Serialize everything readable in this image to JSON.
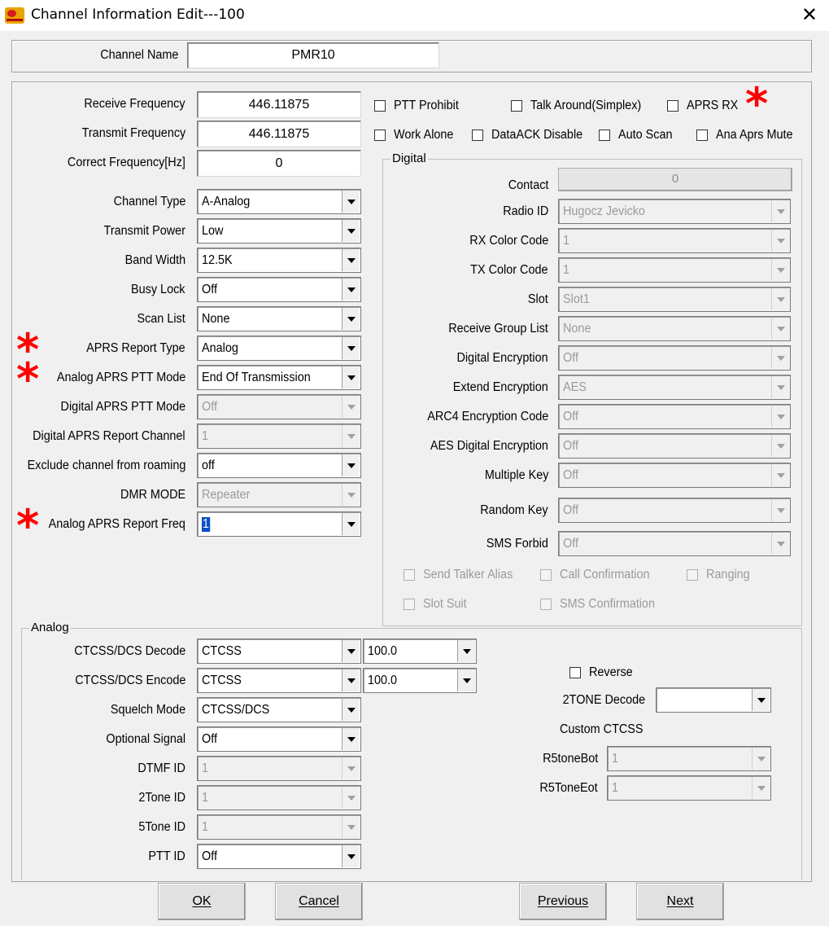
{
  "window": {
    "title": "Channel Information Edit---100",
    "close": "✕"
  },
  "channel_name": {
    "label": "Channel Name",
    "value": "PMR10"
  },
  "left": {
    "receive_frequency": {
      "label": "Receive Frequency",
      "value": "446.11875"
    },
    "transmit_frequency": {
      "label": "Transmit Frequency",
      "value": "446.11875"
    },
    "correct_frequency": {
      "label": "Correct Frequency[Hz]",
      "value": "0"
    },
    "channel_type": {
      "label": "Channel Type",
      "value": "A-Analog"
    },
    "transmit_power": {
      "label": "Transmit Power",
      "value": "Low"
    },
    "band_width": {
      "label": "Band Width",
      "value": "12.5K"
    },
    "busy_lock": {
      "label": "Busy Lock",
      "value": "Off"
    },
    "scan_list": {
      "label": "Scan List",
      "value": "None"
    },
    "aprs_report_type": {
      "label": "APRS Report Type",
      "value": "Analog"
    },
    "analog_aprs_ptt_mode": {
      "label": "Analog APRS PTT Mode",
      "value": "End Of Transmission"
    },
    "digital_aprs_ptt_mode": {
      "label": "Digital APRS PTT Mode",
      "value": "Off"
    },
    "digital_aprs_report_channel": {
      "label": "Digital APRS Report Channel",
      "value": "1"
    },
    "exclude_roaming": {
      "label": "Exclude channel from roaming",
      "value": "off"
    },
    "dmr_mode": {
      "label": "DMR MODE",
      "value": "Repeater"
    },
    "analog_aprs_report_freq": {
      "label": "Analog APRS Report Freq",
      "value": "1"
    }
  },
  "checks": {
    "ptt_prohibit": "PTT Prohibit",
    "talk_around": "Talk Around(Simplex)",
    "aprs_rx": "APRS RX",
    "work_alone": "Work Alone",
    "dataack_disable": "DataACK Disable",
    "auto_scan": "Auto Scan",
    "ana_aprs_mute": "Ana Aprs Mute"
  },
  "digital": {
    "title": "Digital",
    "contact": {
      "label": "Contact",
      "value": "0"
    },
    "radio_id": {
      "label": "Radio ID",
      "value": "Hugocz Jevicko"
    },
    "rx_color_code": {
      "label": "RX Color Code",
      "value": "1"
    },
    "tx_color_code": {
      "label": "TX Color Code",
      "value": "1"
    },
    "slot": {
      "label": "Slot",
      "value": "Slot1"
    },
    "receive_group_list": {
      "label": "Receive Group List",
      "value": "None"
    },
    "digital_encryption": {
      "label": "Digital Encryption",
      "value": "Off"
    },
    "extend_encryption": {
      "label": "Extend Encryption",
      "value": "AES"
    },
    "arc4_encryption_code": {
      "label": "ARC4 Encryption Code",
      "value": "Off"
    },
    "aes_digital_encryption": {
      "label": "AES Digital Encryption",
      "value": "Off"
    },
    "multiple_key": {
      "label": "Multiple Key",
      "value": "Off"
    },
    "random_key": {
      "label": "Random Key",
      "value": "Off"
    },
    "sms_forbid": {
      "label": "SMS Forbid",
      "value": "Off"
    },
    "send_talker_alias": "Send Talker Alias",
    "call_confirmation": "Call Confirmation",
    "ranging": "Ranging",
    "slot_suit": "Slot Suit",
    "sms_confirmation": "SMS Confirmation"
  },
  "analog": {
    "title": "Analog",
    "ctcss_decode": {
      "label": "CTCSS/DCS Decode",
      "value": "CTCSS",
      "tone": "100.0"
    },
    "ctcss_encode": {
      "label": "CTCSS/DCS Encode",
      "value": "CTCSS",
      "tone": "100.0"
    },
    "squelch_mode": {
      "label": "Squelch Mode",
      "value": "CTCSS/DCS"
    },
    "optional_signal": {
      "label": "Optional Signal",
      "value": "Off"
    },
    "dtmf_id": {
      "label": "DTMF ID",
      "value": "1"
    },
    "two_tone_id": {
      "label": "2Tone ID",
      "value": "1"
    },
    "five_tone_id": {
      "label": "5Tone ID",
      "value": "1"
    },
    "ptt_id": {
      "label": "PTT ID",
      "value": "Off"
    },
    "reverse": "Reverse",
    "two_tone_decode": {
      "label": "2TONE Decode",
      "value": ""
    },
    "custom_ctcss": "Custom CTCSS",
    "r5tone_bot": {
      "label": "R5toneBot",
      "value": "1"
    },
    "r5tone_eot": {
      "label": "R5ToneEot",
      "value": "1"
    }
  },
  "buttons": {
    "ok": "OK",
    "cancel": "Cancel",
    "previous": "Previous",
    "next": "Next"
  },
  "colors": {
    "annotation_star": "#ff0000",
    "selection": "#0a4ec8"
  },
  "annotations": {
    "star": "*"
  }
}
